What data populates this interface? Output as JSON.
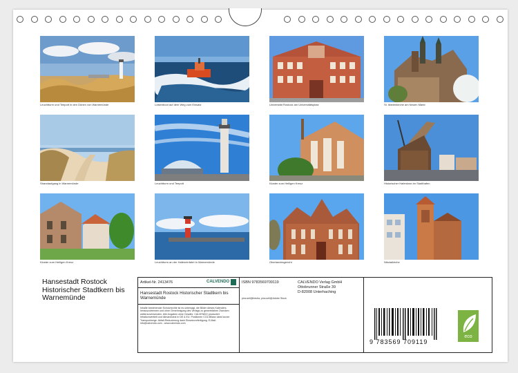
{
  "photos": [
    {
      "caption": "Leuchtturm und Teepott in den Dünen von Warnemünde",
      "scene": "dunes-lighthouse"
    },
    {
      "caption": "Lotsenboot auf dem Weg zum Einsatz",
      "scene": "pilot-boat"
    },
    {
      "caption": "Universität Rostock am Universitätsplatz",
      "scene": "university"
    },
    {
      "caption": "St. Marienkirche am Neuen Markt",
      "scene": "marienkirche"
    },
    {
      "caption": "Strandaufgang in Warnemünde",
      "scene": "beach-path"
    },
    {
      "caption": "Leuchtturm und Teepott",
      "scene": "lighthouse-teepott"
    },
    {
      "caption": "Kloster zum Heiligen Kreuz",
      "scene": "kloster-church"
    },
    {
      "caption": "Historischer Hafenkran im Stadthafen",
      "scene": "harbour-crane"
    },
    {
      "caption": "Kloster zum Heiligen Kreuz",
      "scene": "kloster-courtyard"
    },
    {
      "caption": "Leuchtturm an der Hafeneinfahrt in Warnemünde",
      "scene": "harbour-light"
    },
    {
      "caption": "Oberlandesgericht",
      "scene": "court"
    },
    {
      "caption": "Nikolaikirche",
      "scene": "nikolaikirche"
    }
  ],
  "title": "Hansestadt Rostock Historischer Stadtkern bis Warnemünde",
  "info": {
    "artikel": "Artikel-Nr. 2413476",
    "brand": "CALVENDO",
    "product_title": "Hansestadt Rostock Historischer Stadtkern bis Warnemünde",
    "legal": "Inhalte bestehender Schutzrechte ist es untersagt, die Bilder dieses Kalenders herauszutrennen und ohne Genehmigung des Verlags zu gewerblichen Zwecken weiterzuverwenden. Alle Angaben ohne Gewähr. CALVENDO produziert Iebalkonventielt und klimaneutral in DE & EU. Positionen CO2-Bilanz dank kurzer Transportwege. Abfall-Reduzierung dank Einsetzvorfertigung. E-Mail: info@calvendo.com - www.calvendo.com",
    "isbn": "ISBN 9783569709119",
    "credits": "pixs:sell@fotolia; pixs:sell@Adobe Stock",
    "publisher_name": "CALVENDO Verlag GmbH",
    "publisher_street": "Ottobrunner Straße 39",
    "publisher_city": "D-82008 Unterhaching",
    "barcode_digits": "9 783569 709119",
    "eco_label": "eco"
  }
}
